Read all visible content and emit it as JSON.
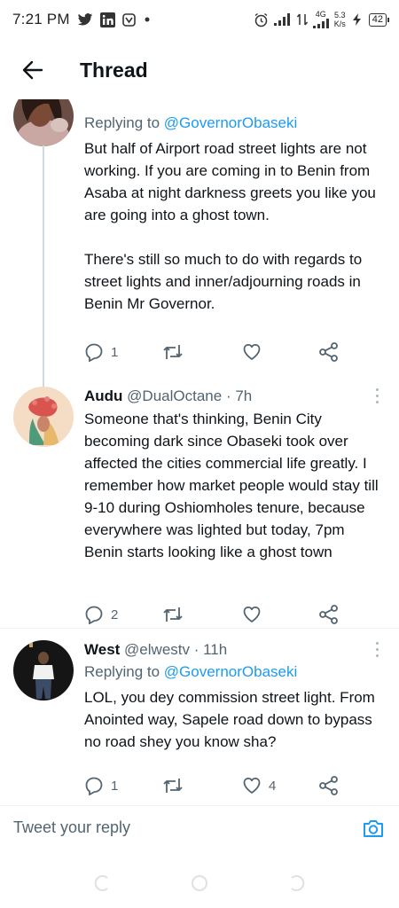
{
  "status_bar": {
    "time": "7:21 PM",
    "network_type": "4G",
    "speed_value": "5.3",
    "speed_unit": "K/s",
    "battery": "42",
    "icons": [
      "twitter-icon",
      "linkedin-icon",
      "vpn-icon",
      "dot-icon",
      "alarm-icon",
      "signal-icon",
      "data-icon",
      "charging-icon",
      "battery-icon"
    ]
  },
  "header": {
    "title": "Thread"
  },
  "tweets": [
    {
      "reply_prefix": "Replying to",
      "reply_to": "@GovernorObaseki",
      "text": "But half of Airport road street lights are not working.  If you are coming in to Benin from Asaba at night darkness greets you like you are going into a ghost town.\n\nThere's still so much to do with regards to street lights and inner/adjourning roads in Benin Mr Governor.",
      "replies": "1",
      "retweets": "",
      "likes": ""
    },
    {
      "name": "Audu",
      "handle": "@DualOctane",
      "time": "· 7h",
      "text": "Someone that's thinking, Benin City becoming dark since Obaseki took over affected the cities commercial life greatly. I remember how market people would stay till 9-10 during Oshiomholes tenure, because everywhere was lighted but today, 7pm Benin starts looking like a ghost town",
      "replies": "2",
      "retweets": "",
      "likes": ""
    },
    {
      "name": "West",
      "handle": "@elwestv",
      "time": "· 11h",
      "reply_prefix": "Replying to",
      "reply_to": "@GovernorObaseki",
      "text": "LOL, you dey commission street light. From Anointed way, Sapele road down to bypass no road shey you know sha?",
      "replies": "1",
      "retweets": "",
      "likes": "4"
    }
  ],
  "reply_bar": {
    "placeholder": "Tweet your reply"
  },
  "colors": {
    "accent": "#1d9bf0",
    "secondary_text": "#536471",
    "primary_text": "#0f1419",
    "divider": "#eff3f4"
  }
}
